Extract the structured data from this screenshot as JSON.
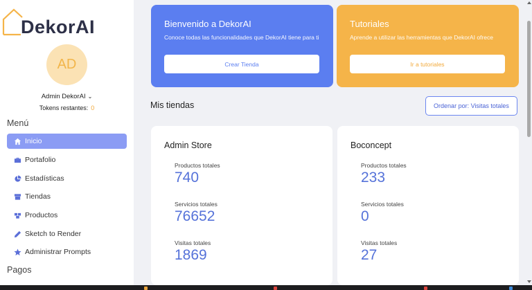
{
  "app": {
    "logo_text": "DekorAI"
  },
  "user": {
    "initials": "AD",
    "name": "Admin DekorAI",
    "tokens_label": "Tokens restantes:",
    "tokens_count": "0"
  },
  "sidebar": {
    "menu_heading": "Menú",
    "items": [
      {
        "label": "Inicio",
        "icon": "home-icon",
        "active": true
      },
      {
        "label": "Portafolio",
        "icon": "briefcase-icon"
      },
      {
        "label": "Estadísticas",
        "icon": "pie-chart-icon"
      },
      {
        "label": "Tiendas",
        "icon": "store-icon"
      },
      {
        "label": "Productos",
        "icon": "boxes-icon"
      },
      {
        "label": "Sketch to Render",
        "icon": "pencil-icon"
      },
      {
        "label": "Administrar Prompts",
        "icon": "star-icon"
      }
    ],
    "payments_heading": "Pagos"
  },
  "welcome_card": {
    "title": "Bienvenido a DekorAI",
    "subtitle": "Conoce todas las funcionalidades que DekorAI tiene para ti",
    "button": "Crear Tienda",
    "color": "#5b7ef0"
  },
  "tutorials_card": {
    "title": "Tutoriales",
    "subtitle": "Aprende a utilizar las herramientas que DekorAI ofrece",
    "button": "Ir a tutoriales",
    "color": "#f5b449"
  },
  "stores_section": {
    "title": "Mis tiendas",
    "sort_button": "Ordenar por: Visitas totales",
    "stores": [
      {
        "name": "Admin Store",
        "products_label": "Productos totales",
        "products": "740",
        "services_label": "Servicios totales",
        "services": "76652",
        "visits_label": "Visitas totales",
        "visits": "1869"
      },
      {
        "name": "Boconcept",
        "products_label": "Productos totales",
        "products": "233",
        "services_label": "Servicios totales",
        "services": "0",
        "visits_label": "Visitas totales",
        "visits": "27"
      }
    ]
  },
  "colors": {
    "accent": "#5b7ef0",
    "orange": "#f5b449",
    "active_nav": "#8b9cf4",
    "value_text": "#5572d9"
  }
}
